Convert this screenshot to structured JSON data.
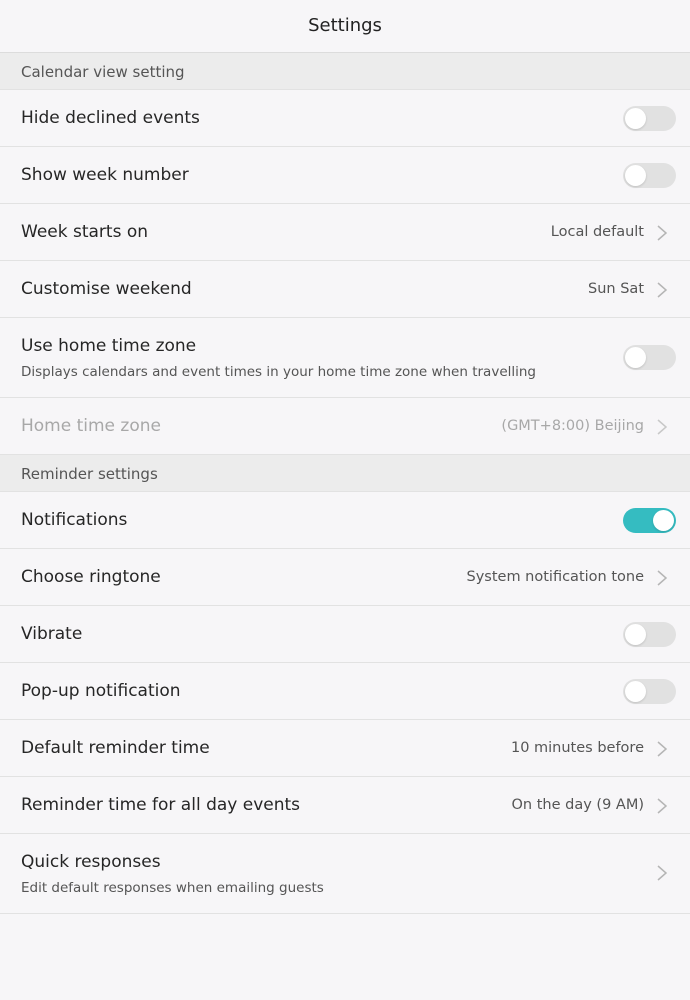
{
  "header": {
    "title": "Settings"
  },
  "sections": {
    "calendar": {
      "title": "Calendar view setting",
      "hide_declined": {
        "label": "Hide declined events",
        "toggle": false
      },
      "week_number": {
        "label": "Show week number",
        "toggle": false
      },
      "week_starts": {
        "label": "Week starts on",
        "value": "Local default"
      },
      "weekend": {
        "label": "Customise weekend",
        "value": "Sun Sat"
      },
      "home_tz_use": {
        "label": "Use home time zone",
        "sub": "Displays calendars and event times in your home time zone when travelling",
        "toggle": false
      },
      "home_tz": {
        "label": "Home time zone",
        "value": "(GMT+8:00) Beijing",
        "disabled": true
      }
    },
    "reminder": {
      "title": "Reminder settings",
      "notifications": {
        "label": "Notifications",
        "toggle": true
      },
      "ringtone": {
        "label": "Choose ringtone",
        "value": "System notification tone"
      },
      "vibrate": {
        "label": "Vibrate",
        "toggle": false
      },
      "popup": {
        "label": "Pop-up notification",
        "toggle": false
      },
      "default_time": {
        "label": "Default reminder time",
        "value": "10 minutes before"
      },
      "all_day_time": {
        "label": "Reminder time for all day events",
        "value": "On the day (9 AM)"
      },
      "quick_responses": {
        "label": "Quick responses",
        "sub": "Edit default responses when emailing guests"
      }
    }
  },
  "colors": {
    "toggle_on": "#35bcc1",
    "toggle_off": "#e1e1e1",
    "background": "#f7f6f8",
    "section_bg": "#ececec"
  },
  "icons": {
    "chevron": "chevron-right-icon"
  }
}
